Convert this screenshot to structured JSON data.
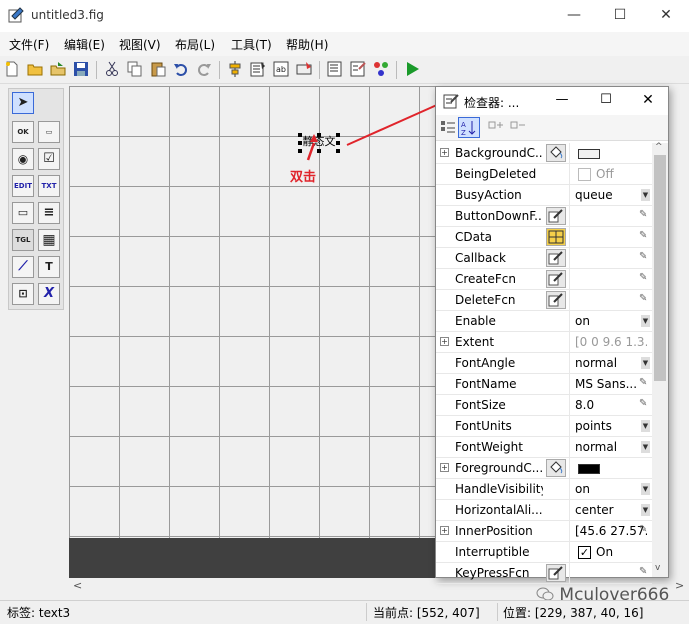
{
  "window": {
    "title": "untitled3.fig",
    "min": "—",
    "max": "☐",
    "close": "✕"
  },
  "menus": [
    "文件(F)",
    "编辑(E)",
    "视图(V)",
    "布局(L)",
    "工具(T)",
    "帮助(H)"
  ],
  "palette": [
    {
      "name": "select-tool",
      "glyph": "➤"
    },
    {
      "name": "push-button-tool",
      "glyph": "OK"
    },
    {
      "name": "slider-tool",
      "glyph": "▭"
    },
    {
      "name": "radio-button-tool",
      "glyph": "◉"
    },
    {
      "name": "checkbox-tool",
      "glyph": "☑"
    },
    {
      "name": "edit-text-tool",
      "glyph": "EDIT"
    },
    {
      "name": "static-text-tool",
      "glyph": "TXT"
    },
    {
      "name": "popup-menu-tool",
      "glyph": "▭"
    },
    {
      "name": "listbox-tool",
      "glyph": "≡"
    },
    {
      "name": "toggle-button-tool",
      "glyph": "TGL"
    },
    {
      "name": "table-tool",
      "glyph": "▦"
    },
    {
      "name": "axes-tool",
      "glyph": "⟋"
    },
    {
      "name": "panel-tool",
      "glyph": "T"
    },
    {
      "name": "button-group-tool",
      "glyph": "⊡"
    },
    {
      "name": "activex-tool",
      "glyph": "X"
    }
  ],
  "canvas": {
    "static_text": "静态文",
    "annotation": "双击"
  },
  "inspector": {
    "title": "检查器: ...",
    "min": "—",
    "max": "☐",
    "close": "✕",
    "properties": [
      {
        "name": "BackgroundC...",
        "expand": true,
        "button": "paint",
        "value": "",
        "swatch": "#f0f0f0",
        "ctl": ""
      },
      {
        "name": "BeingDeleted",
        "expand": false,
        "button": "",
        "value": "Off",
        "gray": true,
        "check": false,
        "ctl": ""
      },
      {
        "name": "BusyAction",
        "expand": false,
        "button": "",
        "value": "queue",
        "ctl": "drop"
      },
      {
        "name": "ButtonDownF...",
        "expand": false,
        "button": "pen",
        "value": "",
        "ctl": "pen"
      },
      {
        "name": "CData",
        "expand": false,
        "button": "grid",
        "value": "",
        "ctl": "pen"
      },
      {
        "name": "Callback",
        "expand": false,
        "button": "pen",
        "value": "",
        "ctl": "pen"
      },
      {
        "name": "CreateFcn",
        "expand": false,
        "button": "pen",
        "value": "",
        "ctl": "pen"
      },
      {
        "name": "DeleteFcn",
        "expand": false,
        "button": "pen",
        "value": "",
        "ctl": "pen"
      },
      {
        "name": "Enable",
        "expand": false,
        "button": "",
        "value": "on",
        "ctl": "drop"
      },
      {
        "name": "Extent",
        "expand": true,
        "button": "",
        "value": "[0 0 9.6 1.3...",
        "gray": true,
        "ctl": ""
      },
      {
        "name": "FontAngle",
        "expand": false,
        "button": "",
        "value": "normal",
        "ctl": "drop"
      },
      {
        "name": "FontName",
        "expand": false,
        "button": "",
        "value": "MS Sans...",
        "ctl": "pen"
      },
      {
        "name": "FontSize",
        "expand": false,
        "button": "",
        "value": "8.0",
        "ctl": "pen"
      },
      {
        "name": "FontUnits",
        "expand": false,
        "button": "",
        "value": "points",
        "ctl": "drop"
      },
      {
        "name": "FontWeight",
        "expand": false,
        "button": "",
        "value": "normal",
        "ctl": "drop"
      },
      {
        "name": "ForegroundC...",
        "expand": true,
        "button": "paint",
        "value": "",
        "swatch": "#000000",
        "ctl": ""
      },
      {
        "name": "HandleVisibility",
        "expand": false,
        "button": "",
        "value": "on",
        "ctl": "drop"
      },
      {
        "name": "HorizontalAli...",
        "expand": false,
        "button": "",
        "value": "center",
        "ctl": "drop"
      },
      {
        "name": "InnerPosition",
        "expand": true,
        "button": "",
        "value": "[45.6 27.57...",
        "ctl": "pen"
      },
      {
        "name": "Interruptible",
        "expand": false,
        "button": "",
        "value": "On",
        "check": true,
        "ctl": ""
      },
      {
        "name": "KeyPressFcn",
        "expand": false,
        "button": "pen",
        "value": "",
        "ctl": "pen"
      }
    ]
  },
  "status": {
    "tag": "标签: text3",
    "current_point": "当前点:  [552, 407]",
    "position": "位置: [229, 387, 40, 16]"
  },
  "watermark": "Mculover666"
}
